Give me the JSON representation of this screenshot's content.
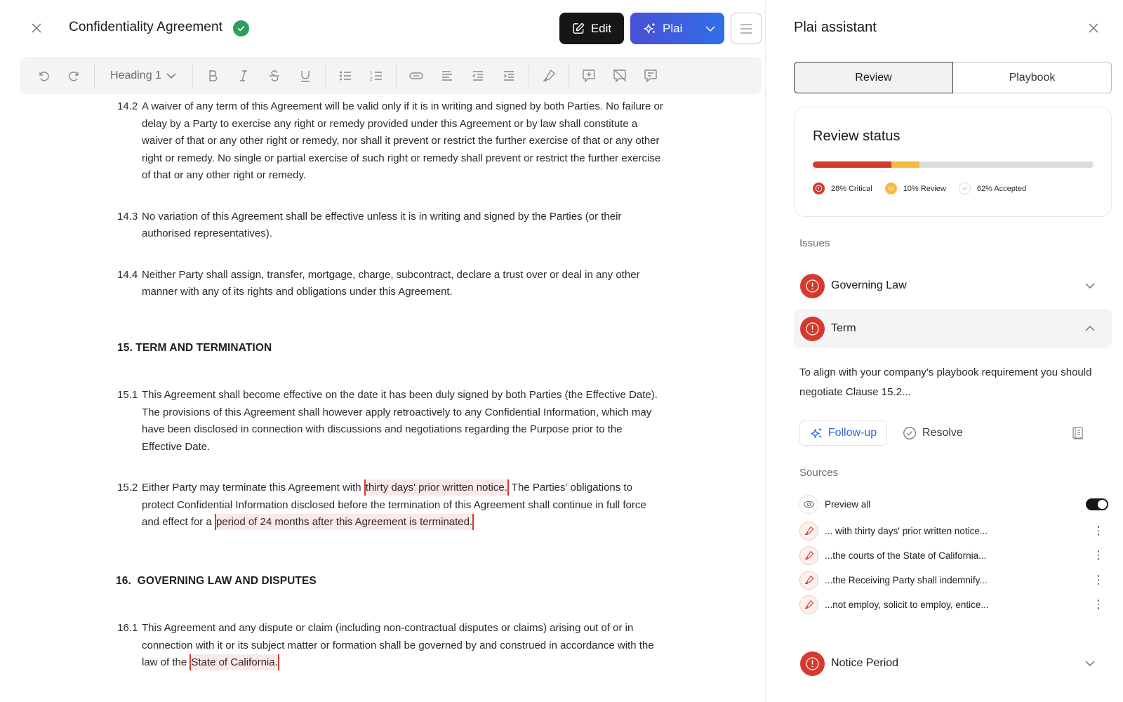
{
  "header": {
    "title": "Confidentiality Agreement",
    "edit_label": "Edit",
    "plai_label": "Plai"
  },
  "toolbar": {
    "heading_style": "Heading 1"
  },
  "document": {
    "clause_14_2": {
      "num": "14.2",
      "text": "A waiver of any term of this Agreement will be valid only if it is in writing and signed by both Parties. No failure or delay by a Party to exercise any right or remedy provided under this Agreement or by law shall constitute a waiver of that or any other right or remedy, nor shall it prevent or restrict the further exercise of that or any other right or remedy. No single or partial exercise of such right or remedy shall prevent or restrict the further exercise of that or any other right or remedy."
    },
    "clause_14_3": {
      "num": "14.3",
      "text": "No variation of this Agreement shall be effective unless it is in writing and signed by the Parties (or their authorised representatives)."
    },
    "clause_14_4": {
      "num": "14.4",
      "text": "Neither Party shall assign, transfer, mortgage, charge, subcontract, declare a trust over or deal in any other manner with any of its rights and obligations under this Agreement."
    },
    "heading_15": "15. TERM AND TERMINATION",
    "clause_15_1": {
      "num": "15.1",
      "text": "This Agreement shall become effective on the date it has been duly signed by both Parties (the Effective Date). The provisions of this Agreement shall however apply retroactively to any Confidential Information, which may have been disclosed in connection with discussions and negotiations regarding the Purpose prior to the Effective Date."
    },
    "clause_15_2": {
      "num": "15.2",
      "part1": "Either Party may terminate this Agreement with ",
      "highlight1": "thirty days' prior written notice.",
      "part2": " The Parties' obligations to protect Confidential Information disclosed before the termination of this Agreement shall continue in full force and effect for a ",
      "highlight2": "period of 24 months after this Agreement is terminated."
    },
    "heading_16": "16.  GOVERNING LAW AND DISPUTES",
    "clause_16_1": {
      "num": "16.1",
      "part1": "This Agreement and any dispute or claim (including non-contractual disputes or claims) arising out of or in connection with it or its subject matter or formation shall be governed by and construed in accordance with the law of the ",
      "highlight1": "State of California."
    }
  },
  "panel": {
    "title": "Plai assistant",
    "tabs": [
      {
        "label": "Review",
        "active": true
      },
      {
        "label": "Playbook",
        "active": false
      }
    ],
    "review_status": {
      "title": "Review status",
      "critical_pct": 28,
      "review_pct": 10,
      "accepted_pct": 62,
      "critical_label": "28% Critical",
      "review_label": "10% Review",
      "accepted_label": "62% Accepted",
      "colors": {
        "critical": "#d63a2d",
        "review": "#f7ba3e",
        "accepted": "#dcdcde"
      }
    },
    "issues_label": "Issues",
    "issues": [
      {
        "name": "Governing Law",
        "expanded": false
      },
      {
        "name": "Term",
        "expanded": true
      },
      {
        "name": "Notice Period",
        "expanded": false
      }
    ],
    "term_detail": {
      "description": "To align with your company's playbook requirement you should negotiate Clause 15.2...",
      "follow_up_label": "Follow-up",
      "resolve_label": "Resolve"
    },
    "sources_label": "Sources",
    "preview_all_label": "Preview all",
    "preview_all_on": true,
    "sources": [
      "... with thirty days' prior written notice...",
      "...the courts of the State of California...",
      "...the Receiving Party shall indemnify...",
      "...not employ, solicit to employ, entice..."
    ]
  }
}
